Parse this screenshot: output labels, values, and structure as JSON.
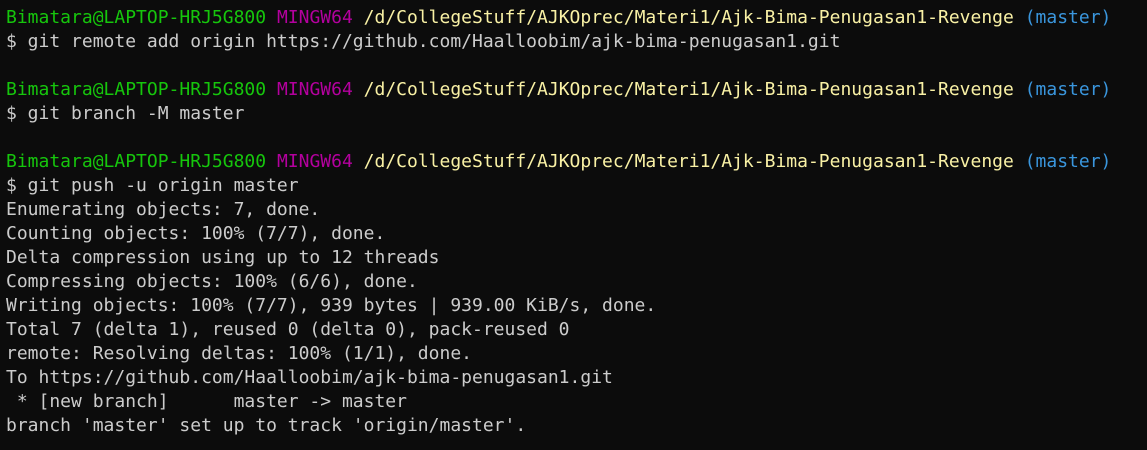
{
  "colors": {
    "background": "#0c0c0c",
    "foreground": "#cccccc",
    "user_host": "#16c60c",
    "system": "#b4009e",
    "path": "#f9f1a5",
    "branch": "#3a96dd"
  },
  "prompt": {
    "user_host": "Bimatara@LAPTOP-HRJ5G800",
    "system": "MINGW64",
    "path": "/d/CollegeStuff/AJKOprec/Materi1/Ajk-Bima-Penugasan1-Revenge",
    "branch": "(master)"
  },
  "commands": [
    "$ git remote add origin https://github.com/Haalloobim/ajk-bima-penugasan1.git",
    "$ git branch -M master",
    "$ git push -u origin master"
  ],
  "output": [
    "Enumerating objects: 7, done.",
    "Counting objects: 100% (7/7), done.",
    "Delta compression using up to 12 threads",
    "Compressing objects: 100% (6/6), done.",
    "Writing objects: 100% (7/7), 939 bytes | 939.00 KiB/s, done.",
    "Total 7 (delta 1), reused 0 (delta 0), pack-reused 0",
    "remote: Resolving deltas: 100% (1/1), done.",
    "To https://github.com/Haalloobim/ajk-bima-penugasan1.git",
    " * [new branch]      master -> master",
    "branch 'master' set up to track 'origin/master'."
  ]
}
